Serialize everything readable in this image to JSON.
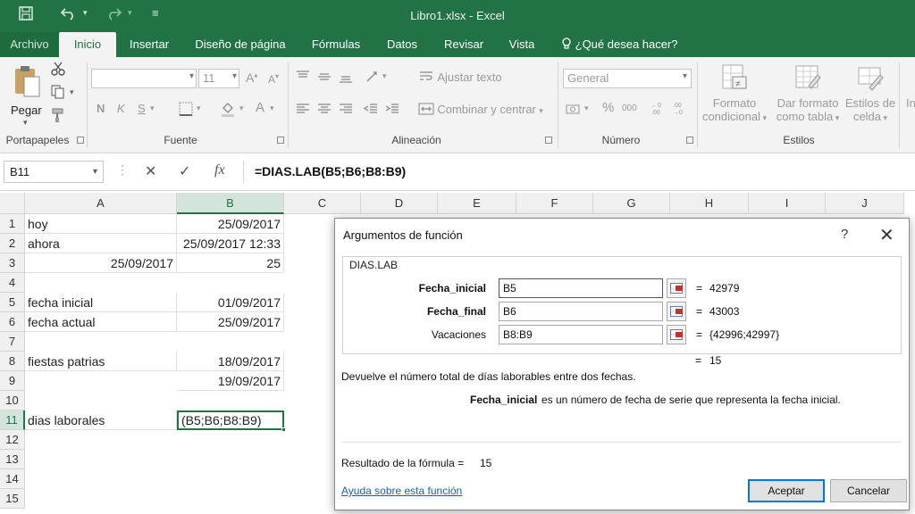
{
  "window": {
    "title": "Libro1.xlsx  -  Excel"
  },
  "quick_access": {
    "save_icon": "save-icon",
    "undo_icon": "undo-icon",
    "redo_icon": "redo-icon"
  },
  "tabs": {
    "file": "Archivo",
    "items": [
      "Inicio",
      "Insertar",
      "Diseño de página",
      "Fórmulas",
      "Datos",
      "Revisar",
      "Vista"
    ],
    "active": "Inicio",
    "tell_me": "¿Qué desea hacer?"
  },
  "ribbon": {
    "clipboard": {
      "paste": "Pegar",
      "group": "Portapapeles"
    },
    "font": {
      "size": "11",
      "bold": "N",
      "italic": "K",
      "underline": "S",
      "group": "Fuente"
    },
    "alignment": {
      "wrap": "Ajustar texto",
      "merge": "Combinar y centrar",
      "group": "Alineación"
    },
    "number": {
      "format": "General",
      "percent": "%",
      "thousands": "000",
      "group": "Número"
    },
    "styles": {
      "conditional_1": "Formato",
      "conditional_2": "condicional",
      "table_1": "Dar formato",
      "table_2": "como tabla",
      "cell_1": "Estilos de",
      "cell_2": "celda",
      "group": "Estilos"
    },
    "extra": "In"
  },
  "formula_bar": {
    "name_box": "B11",
    "cancel": "✕",
    "enter": "✓",
    "fx": "fx",
    "formula": "=DIAS.LAB(B5;B6;B8:B9)"
  },
  "grid": {
    "columns": [
      "A",
      "B",
      "C",
      "D",
      "E",
      "F",
      "G",
      "H",
      "I",
      "J"
    ],
    "rows": [
      "1",
      "2",
      "3",
      "4",
      "5",
      "6",
      "7",
      "8",
      "9",
      "10",
      "11",
      "12",
      "13",
      "14",
      "15"
    ],
    "cells": {
      "A1": "hoy",
      "B1": "25/09/2017",
      "A2": "ahora",
      "B2": "25/09/2017 12:33",
      "A3": "25/09/2017",
      "B3": "25",
      "A5": "fecha inicial",
      "B5": "01/09/2017",
      "A6": "fecha actual",
      "B6": "25/09/2017",
      "A8": "fiestas patrias",
      "B8": "18/09/2017",
      "B9": "19/09/2017",
      "A11": "dias laborales",
      "B11": "(B5;B6;B8:B9)"
    }
  },
  "dialog": {
    "title": "Argumentos de función",
    "help": "?",
    "close": "✕",
    "function_name": "DIAS.LAB",
    "args": [
      {
        "label": "Fecha_inicial",
        "value": "B5",
        "result": "42979"
      },
      {
        "label": "Fecha_final",
        "value": "B6",
        "result": "43003"
      },
      {
        "label": "Vacaciones",
        "value": "B8:B9",
        "result": "{42996;42997}"
      }
    ],
    "equals": "=",
    "overall_result": "15",
    "description": "Devuelve el número total de días laborables entre dos fechas.",
    "arg_help_name": "Fecha_inicial",
    "arg_help_text": "es un número de fecha de serie que representa la fecha inicial.",
    "formula_result_label": "Resultado de la fórmula =",
    "formula_result_value": "15",
    "help_link": "Ayuda sobre esta función",
    "ok": "Aceptar",
    "cancel": "Cancelar"
  },
  "colors": {
    "excel_green": "#217346",
    "ribbon_bg": "#f3f3f3",
    "link": "#1a5fb4",
    "ok_border": "#0078d7"
  }
}
